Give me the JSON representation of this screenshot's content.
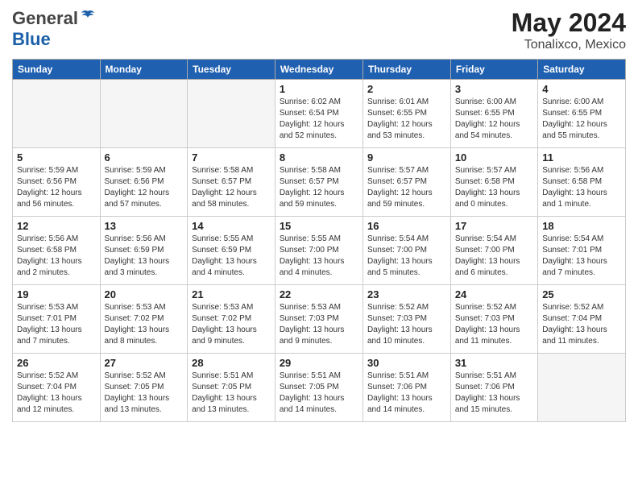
{
  "header": {
    "logo_general": "General",
    "logo_blue": "Blue",
    "month_year": "May 2024",
    "location": "Tonalixco, Mexico"
  },
  "weekdays": [
    "Sunday",
    "Monday",
    "Tuesday",
    "Wednesday",
    "Thursday",
    "Friday",
    "Saturday"
  ],
  "weeks": [
    [
      {
        "day": "",
        "info": ""
      },
      {
        "day": "",
        "info": ""
      },
      {
        "day": "",
        "info": ""
      },
      {
        "day": "1",
        "info": "Sunrise: 6:02 AM\nSunset: 6:54 PM\nDaylight: 12 hours\nand 52 minutes."
      },
      {
        "day": "2",
        "info": "Sunrise: 6:01 AM\nSunset: 6:55 PM\nDaylight: 12 hours\nand 53 minutes."
      },
      {
        "day": "3",
        "info": "Sunrise: 6:00 AM\nSunset: 6:55 PM\nDaylight: 12 hours\nand 54 minutes."
      },
      {
        "day": "4",
        "info": "Sunrise: 6:00 AM\nSunset: 6:55 PM\nDaylight: 12 hours\nand 55 minutes."
      }
    ],
    [
      {
        "day": "5",
        "info": "Sunrise: 5:59 AM\nSunset: 6:56 PM\nDaylight: 12 hours\nand 56 minutes."
      },
      {
        "day": "6",
        "info": "Sunrise: 5:59 AM\nSunset: 6:56 PM\nDaylight: 12 hours\nand 57 minutes."
      },
      {
        "day": "7",
        "info": "Sunrise: 5:58 AM\nSunset: 6:57 PM\nDaylight: 12 hours\nand 58 minutes."
      },
      {
        "day": "8",
        "info": "Sunrise: 5:58 AM\nSunset: 6:57 PM\nDaylight: 12 hours\nand 59 minutes."
      },
      {
        "day": "9",
        "info": "Sunrise: 5:57 AM\nSunset: 6:57 PM\nDaylight: 12 hours\nand 59 minutes."
      },
      {
        "day": "10",
        "info": "Sunrise: 5:57 AM\nSunset: 6:58 PM\nDaylight: 13 hours\nand 0 minutes."
      },
      {
        "day": "11",
        "info": "Sunrise: 5:56 AM\nSunset: 6:58 PM\nDaylight: 13 hours\nand 1 minute."
      }
    ],
    [
      {
        "day": "12",
        "info": "Sunrise: 5:56 AM\nSunset: 6:58 PM\nDaylight: 13 hours\nand 2 minutes."
      },
      {
        "day": "13",
        "info": "Sunrise: 5:56 AM\nSunset: 6:59 PM\nDaylight: 13 hours\nand 3 minutes."
      },
      {
        "day": "14",
        "info": "Sunrise: 5:55 AM\nSunset: 6:59 PM\nDaylight: 13 hours\nand 4 minutes."
      },
      {
        "day": "15",
        "info": "Sunrise: 5:55 AM\nSunset: 7:00 PM\nDaylight: 13 hours\nand 4 minutes."
      },
      {
        "day": "16",
        "info": "Sunrise: 5:54 AM\nSunset: 7:00 PM\nDaylight: 13 hours\nand 5 minutes."
      },
      {
        "day": "17",
        "info": "Sunrise: 5:54 AM\nSunset: 7:00 PM\nDaylight: 13 hours\nand 6 minutes."
      },
      {
        "day": "18",
        "info": "Sunrise: 5:54 AM\nSunset: 7:01 PM\nDaylight: 13 hours\nand 7 minutes."
      }
    ],
    [
      {
        "day": "19",
        "info": "Sunrise: 5:53 AM\nSunset: 7:01 PM\nDaylight: 13 hours\nand 7 minutes."
      },
      {
        "day": "20",
        "info": "Sunrise: 5:53 AM\nSunset: 7:02 PM\nDaylight: 13 hours\nand 8 minutes."
      },
      {
        "day": "21",
        "info": "Sunrise: 5:53 AM\nSunset: 7:02 PM\nDaylight: 13 hours\nand 9 minutes."
      },
      {
        "day": "22",
        "info": "Sunrise: 5:53 AM\nSunset: 7:03 PM\nDaylight: 13 hours\nand 9 minutes."
      },
      {
        "day": "23",
        "info": "Sunrise: 5:52 AM\nSunset: 7:03 PM\nDaylight: 13 hours\nand 10 minutes."
      },
      {
        "day": "24",
        "info": "Sunrise: 5:52 AM\nSunset: 7:03 PM\nDaylight: 13 hours\nand 11 minutes."
      },
      {
        "day": "25",
        "info": "Sunrise: 5:52 AM\nSunset: 7:04 PM\nDaylight: 13 hours\nand 11 minutes."
      }
    ],
    [
      {
        "day": "26",
        "info": "Sunrise: 5:52 AM\nSunset: 7:04 PM\nDaylight: 13 hours\nand 12 minutes."
      },
      {
        "day": "27",
        "info": "Sunrise: 5:52 AM\nSunset: 7:05 PM\nDaylight: 13 hours\nand 13 minutes."
      },
      {
        "day": "28",
        "info": "Sunrise: 5:51 AM\nSunset: 7:05 PM\nDaylight: 13 hours\nand 13 minutes."
      },
      {
        "day": "29",
        "info": "Sunrise: 5:51 AM\nSunset: 7:05 PM\nDaylight: 13 hours\nand 14 minutes."
      },
      {
        "day": "30",
        "info": "Sunrise: 5:51 AM\nSunset: 7:06 PM\nDaylight: 13 hours\nand 14 minutes."
      },
      {
        "day": "31",
        "info": "Sunrise: 5:51 AM\nSunset: 7:06 PM\nDaylight: 13 hours\nand 15 minutes."
      },
      {
        "day": "",
        "info": ""
      }
    ]
  ]
}
